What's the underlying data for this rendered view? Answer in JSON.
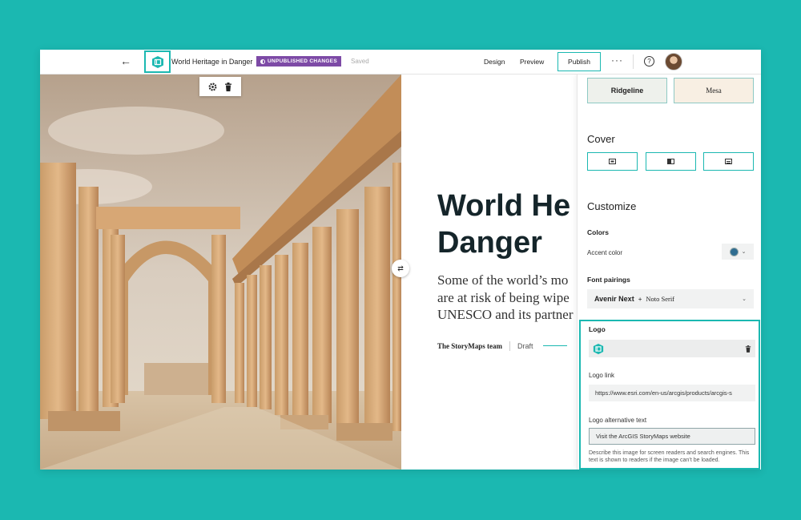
{
  "topbar": {
    "back_icon": "arrow-left-icon",
    "logo_icon": "storymaps-logo-icon",
    "story_title": "World Heritage in Danger",
    "badge": "UNPUBLISHED CHANGES",
    "saved": "Saved",
    "nav_design": "Design",
    "nav_preview": "Preview",
    "publish": "Publish",
    "more": "···",
    "help": "?",
    "accent": "#1bb8b1",
    "badge_color": "#7d4aa6"
  },
  "image_toolbar": {
    "settings_icon": "gear-icon",
    "delete_icon": "trash-icon"
  },
  "story": {
    "title": "World He\nDanger",
    "subtitle": "Some of the world’s mo\nare at risk of being wipe\nUNESCO and its partner",
    "author": "The StoryMaps team",
    "status": "Draft"
  },
  "panel": {
    "themes": [
      "Ridgeline",
      "Mesa"
    ],
    "cover_title": "Cover",
    "customize_title": "Customize",
    "colors_label": "Colors",
    "accent_label": "Accent color",
    "accent_value": "#2f6d91",
    "font_label": "Font pairings",
    "font_primary": "Avenir Next",
    "font_plus": "+",
    "font_secondary": "Noto Serif",
    "logo_label": "Logo",
    "logo_link_label": "Logo link",
    "logo_link_value": "https://www.esri.com/en-us/arcgis/products/arcgis-s",
    "logo_alt_label": "Logo alternative text",
    "logo_alt_value": "Visit the ArcGIS StoryMaps website",
    "logo_help": "Describe this image for screen readers and search engines. This text is shown to readers if the image can’t be loaded."
  }
}
